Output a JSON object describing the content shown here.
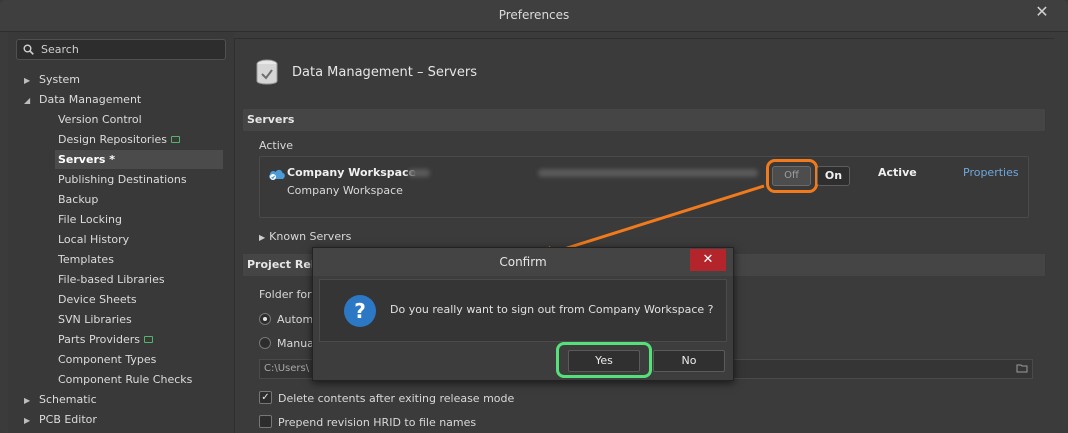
{
  "window": {
    "title": "Preferences"
  },
  "search": {
    "placeholder": "Search"
  },
  "tree": [
    {
      "label": "System",
      "level": 0,
      "arrow": "right"
    },
    {
      "label": "Data Management",
      "level": 0,
      "arrow": "down"
    },
    {
      "label": "Version Control",
      "level": 1
    },
    {
      "label": "Design Repositories",
      "level": 1,
      "server_icon": true
    },
    {
      "label": "Servers *",
      "level": 1,
      "selected": true
    },
    {
      "label": "Publishing Destinations",
      "level": 1
    },
    {
      "label": "Backup",
      "level": 1
    },
    {
      "label": "File Locking",
      "level": 1
    },
    {
      "label": "Local History",
      "level": 1
    },
    {
      "label": "Templates",
      "level": 1
    },
    {
      "label": "File-based Libraries",
      "level": 1
    },
    {
      "label": "Device Sheets",
      "level": 1
    },
    {
      "label": "SVN Libraries",
      "level": 1
    },
    {
      "label": "Parts Providers",
      "level": 1,
      "server_icon": true
    },
    {
      "label": "Component Types",
      "level": 1
    },
    {
      "label": "Component Rule Checks",
      "level": 1
    },
    {
      "label": "Schematic",
      "level": 0,
      "arrow": "right"
    },
    {
      "label": "PCB Editor",
      "level": 0,
      "arrow": "right"
    }
  ],
  "page": {
    "title": "Data Management – Servers"
  },
  "servers_section": {
    "header": "Servers",
    "active_label": "Active",
    "server_name": "Company Workspace",
    "server_sub": "Company Workspace",
    "toggle_off": "Off",
    "toggle_on": "On",
    "status": "Active",
    "properties_link": "Properties",
    "known_servers": "Known Servers"
  },
  "project_release": {
    "header": "Project Relea",
    "folder_label": "Folder for",
    "radio_auto": "Automa",
    "radio_manual": "Manua",
    "path_value": "C:\\Users\\",
    "delete_contents": "Delete contents after exiting release mode",
    "prepend_revision": "Prepend revision HRID to file names"
  },
  "dialog": {
    "title": "Confirm",
    "close": "✕",
    "icon": "?",
    "message": "Do you really want to sign out from Company Workspace ?",
    "yes": "Yes",
    "no": "No"
  },
  "colors": {
    "annotation_orange": "#f07a1c",
    "annotation_green": "#55e07a",
    "dialog_close": "#b3242b",
    "link": "#6fa8dc"
  }
}
